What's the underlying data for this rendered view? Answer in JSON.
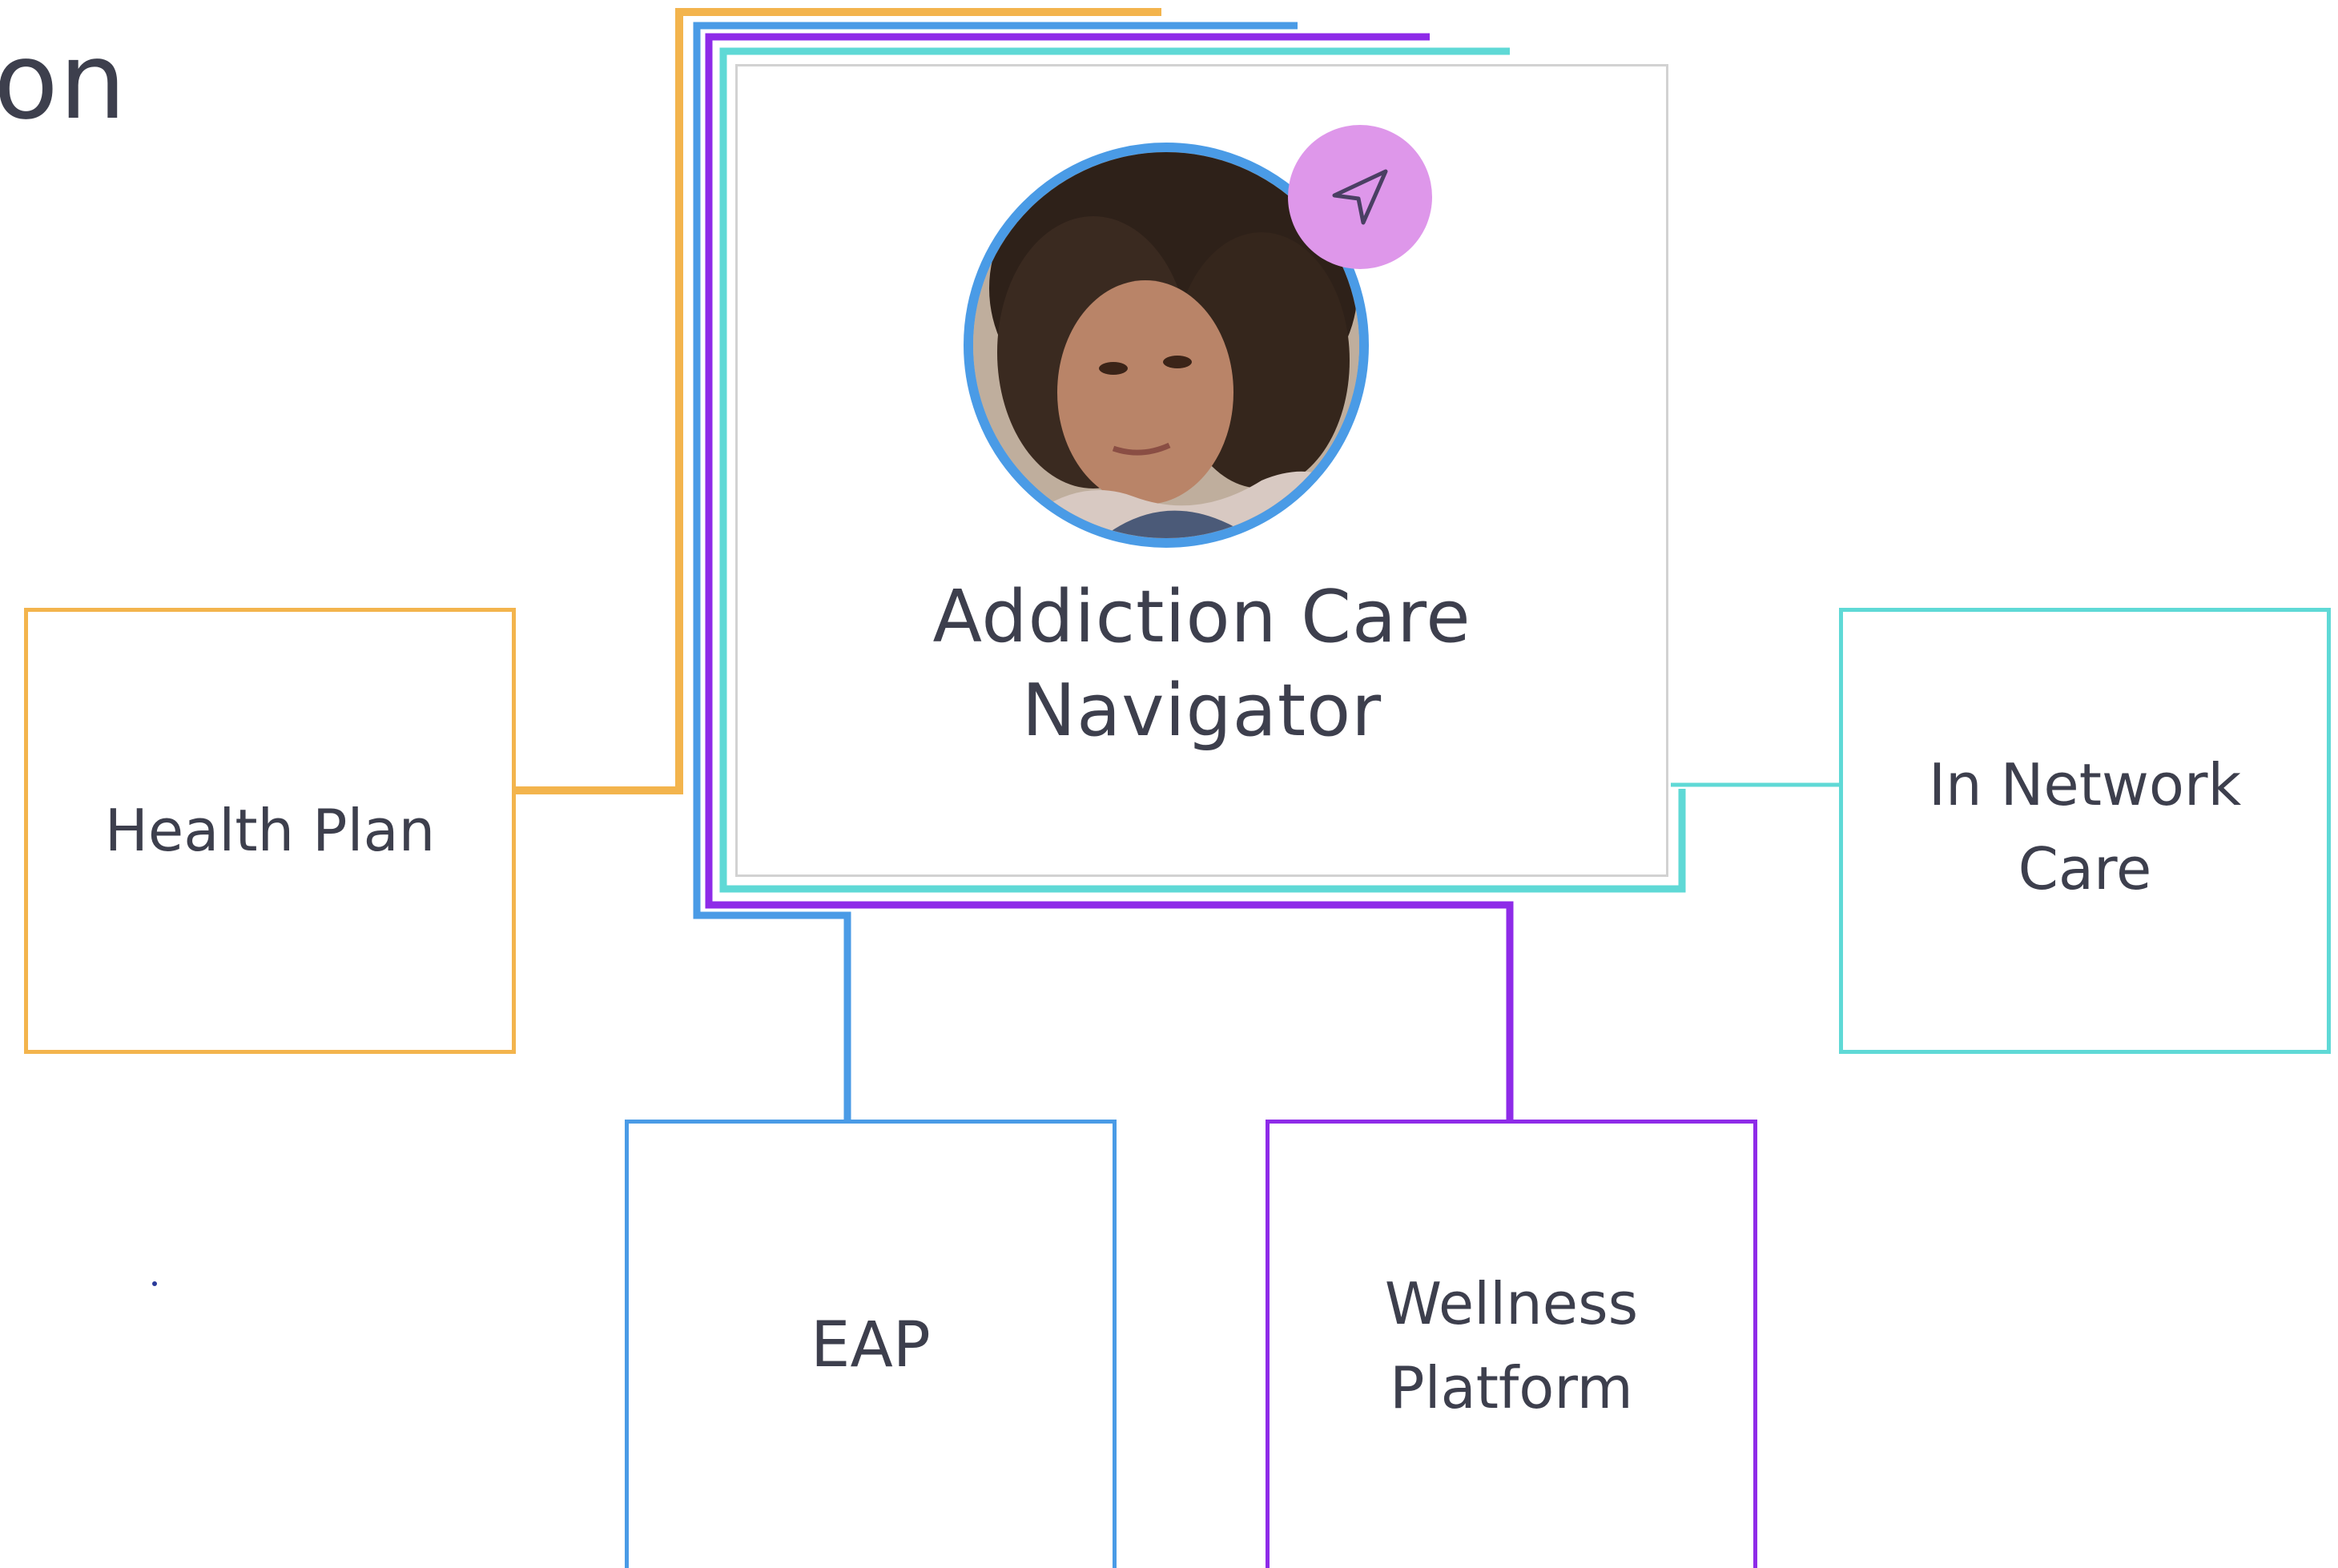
{
  "heading": {
    "visible_text": "on"
  },
  "hub": {
    "title_line1": "Addiction Care",
    "title_line2": "Navigator",
    "badge_icon": "send-arrow-icon",
    "avatar": "person-photo"
  },
  "nodes": {
    "health_plan": {
      "label": "Health Plan"
    },
    "in_network": {
      "line1": "In Network",
      "line2": "Care"
    },
    "eap": {
      "label": "EAP"
    },
    "wellness": {
      "line1": "Wellness",
      "line2": "Platform"
    }
  },
  "colors": {
    "health_plan": "#f3b44d",
    "eap": "#4a9be6",
    "wellness": "#8e2be8",
    "in_network": "#5fd9d6",
    "badge": "#de97ea",
    "text": "#3d3f4d"
  }
}
